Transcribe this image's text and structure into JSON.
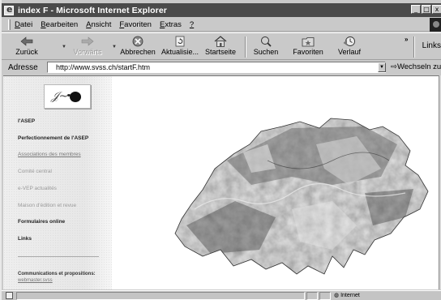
{
  "window": {
    "title": "index F - Microsoft Internet Explorer",
    "controls": [
      "_",
      "□",
      "x"
    ]
  },
  "menu": {
    "items": [
      {
        "first": "D",
        "rest": "atei"
      },
      {
        "first": "B",
        "rest": "earbeiten"
      },
      {
        "first": "A",
        "rest": "nsicht"
      },
      {
        "first": "F",
        "rest": "avoriten"
      },
      {
        "first": "E",
        "rest": "xtras"
      },
      {
        "first": "?",
        "rest": ""
      }
    ]
  },
  "toolbar": {
    "back": "Zurück",
    "forward": "Vorwärts",
    "stop": "Abbrechen",
    "refresh": "Aktualisie...",
    "home": "Startseite",
    "search": "Suchen",
    "favorites": "Favoriten",
    "history": "Verlauf",
    "links": "Links",
    "more": "»"
  },
  "address": {
    "label": "Adresse",
    "url": "http://www.svss.ch/startF.htm",
    "go": "Wechseln zu"
  },
  "sidebar": {
    "items": [
      {
        "label": "l'ASEP",
        "style": "bold"
      },
      {
        "label": "Perfectionnement de l'ASEP",
        "style": "bold"
      },
      {
        "label": "Associations des membres",
        "style": "active"
      },
      {
        "label": "Comité central",
        "style": "light"
      },
      {
        "label": "e-VEP actualités",
        "style": "light"
      },
      {
        "label": "Maison d'édition et revue",
        "style": "light"
      },
      {
        "label": "Formulaires online",
        "style": "bold"
      },
      {
        "label": "Links",
        "style": "bold"
      }
    ],
    "footer": "Communications et propositions:",
    "footer_link": "webmaster.svss"
  },
  "status": {
    "zone": "Internet"
  }
}
